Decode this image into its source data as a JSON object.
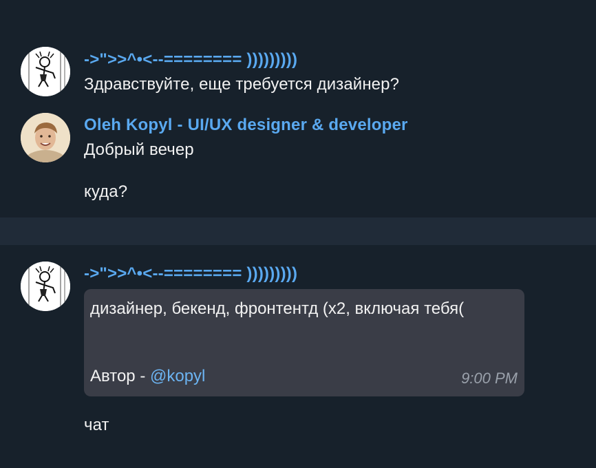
{
  "messages": [
    {
      "sender": "->\">>^•<--======== )))))))))",
      "text": "Здравствуйте, еще требуется дизайнер?",
      "avatar_icon": "sketch-figure-avatar"
    },
    {
      "sender": "Oleh Kopyl - UI/UX designer & developer",
      "lines": [
        "Добрый вечер",
        "куда?"
      ],
      "avatar_icon": "portrait-photo-avatar"
    },
    {
      "sender": "->\">>^•<--======== )))))))))",
      "bubble": {
        "text": "дизайнер, бекенд, фронтентд (x2, включая тебя(",
        "author_prefix": "Автор - ",
        "mention": "@kopyl",
        "time": "9:00 PM"
      },
      "after": "чат",
      "avatar_icon": "sketch-figure-avatar"
    }
  ],
  "colors": {
    "background": "#17212b",
    "divider": "#202b38",
    "sender_name": "#5aa9f0",
    "bubble": "#3a3d47",
    "mention": "#6cb4f2"
  }
}
